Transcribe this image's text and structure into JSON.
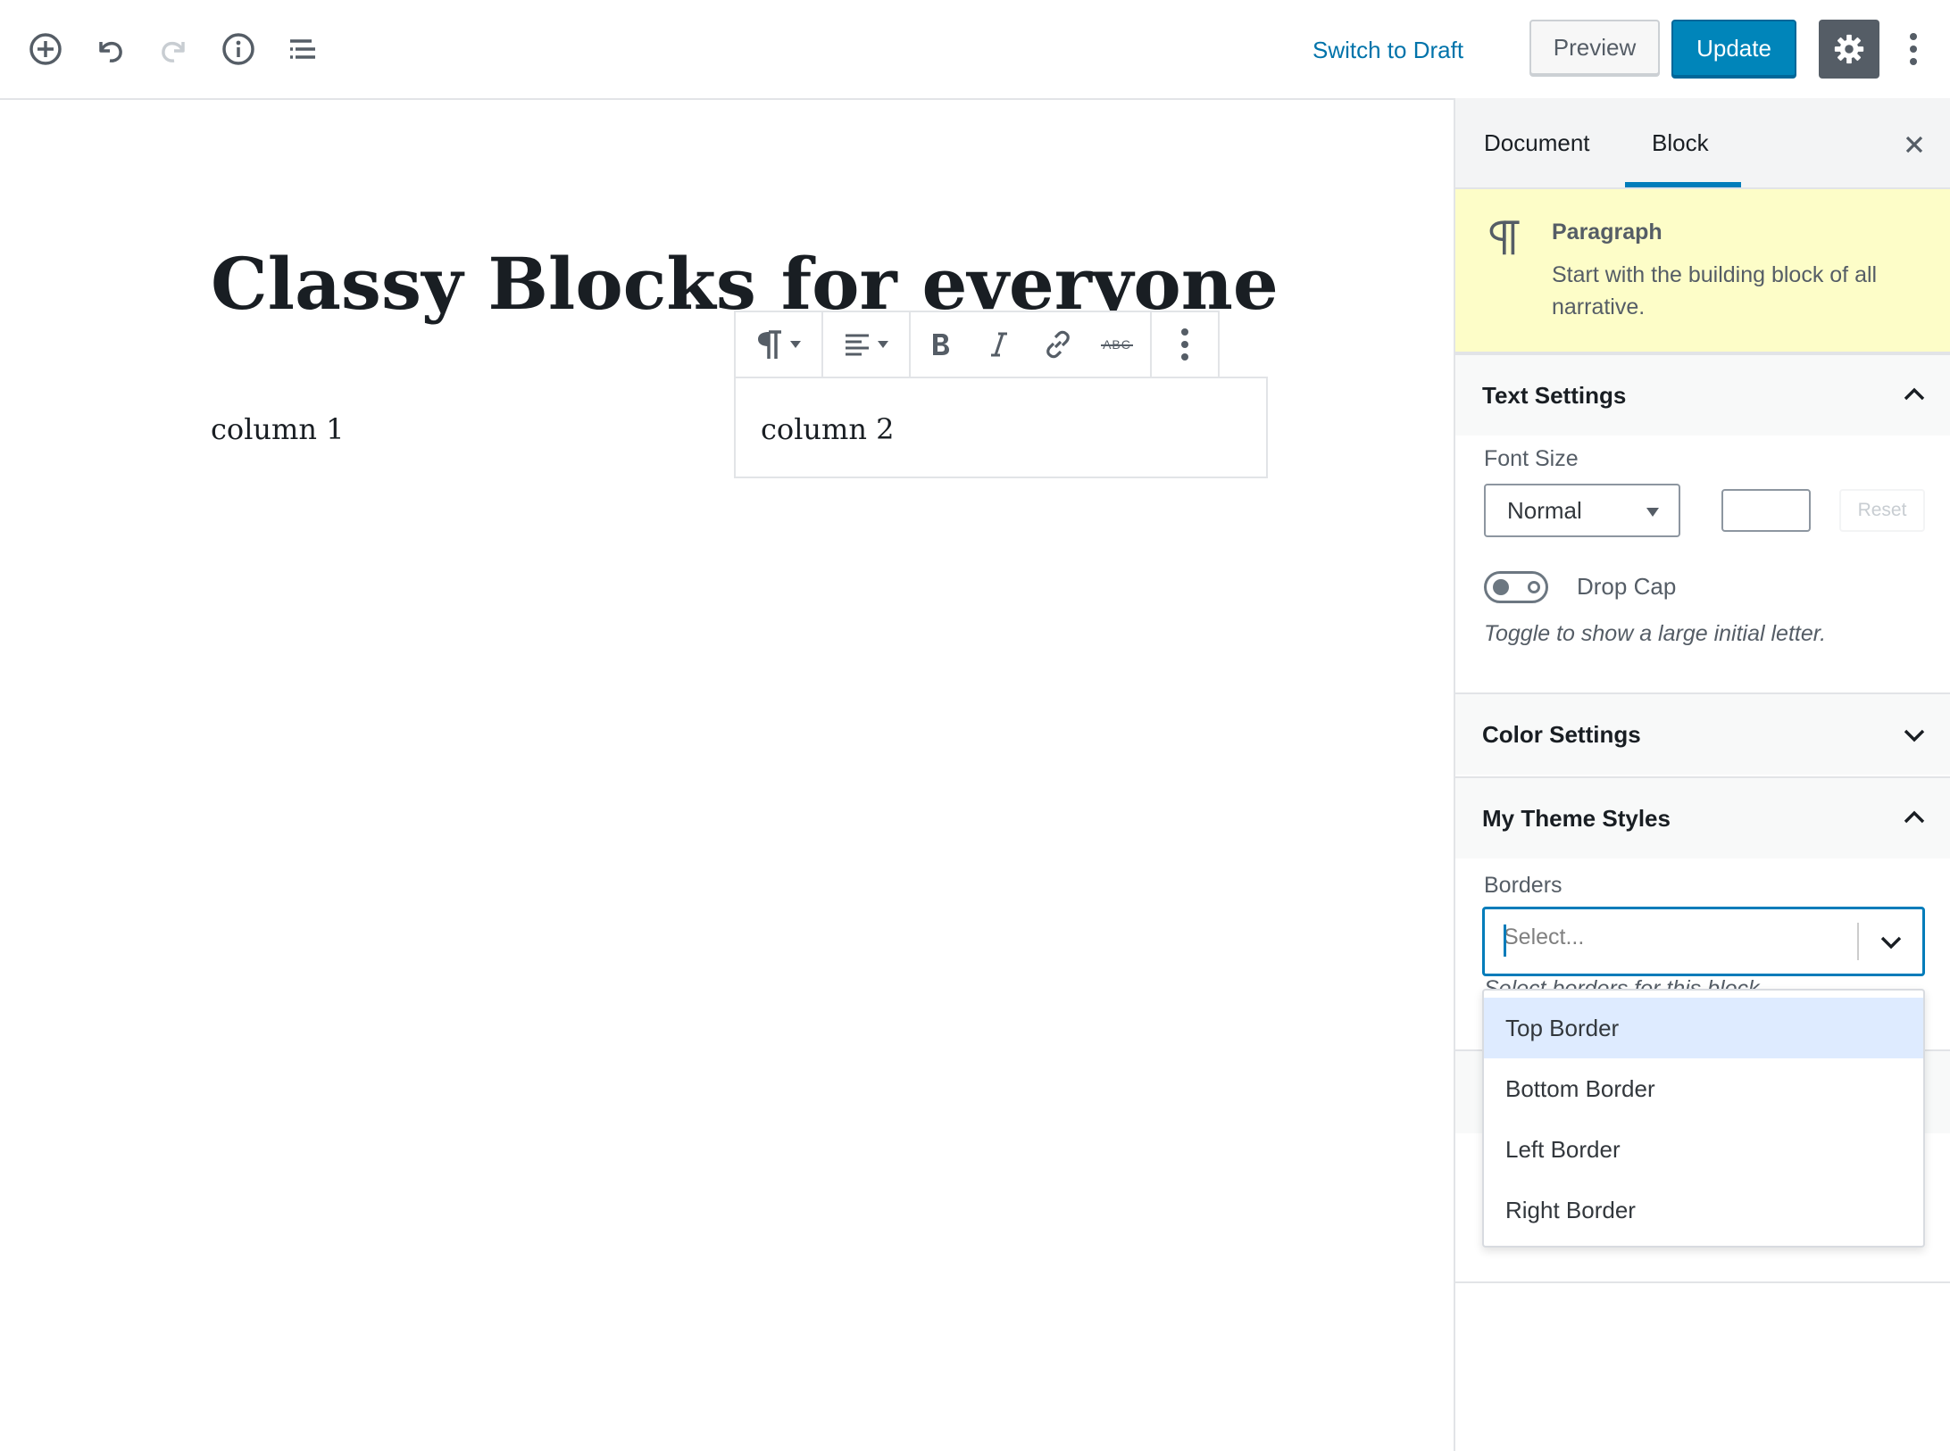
{
  "toolbar": {
    "add_block_icon": "plus-circle-icon",
    "undo_icon": "undo-icon",
    "redo_icon": "redo-icon",
    "info_icon": "info-icon",
    "outline_icon": "list-outline-icon",
    "switch_to_draft": "Switch to Draft",
    "preview": "Preview",
    "update": "Update",
    "settings_icon": "gear-icon",
    "more_icon": "vertical-ellipsis-icon"
  },
  "editor": {
    "title": "Classy Blocks for everyone",
    "column_1": "column 1",
    "column_2": "column 2"
  },
  "block_toolbar": {
    "items": [
      "paragraph-icon",
      "align-left-icon",
      "bold-icon",
      "italic-icon",
      "link-icon",
      "strikethrough-icon",
      "more-options-icon"
    ],
    "strikethrough_text": "ABC"
  },
  "sidebar": {
    "tabs": [
      "Document",
      "Block"
    ],
    "active_tab": "Block",
    "block_card": {
      "title": "Paragraph",
      "description": "Start with the building block of all narrative."
    },
    "text_settings": {
      "title": "Text Settings",
      "font_size_label": "Font Size",
      "font_size_value": "Normal",
      "reset": "Reset",
      "drop_cap_label": "Drop Cap",
      "drop_cap_help": "Toggle to show a large initial letter."
    },
    "color_settings": {
      "title": "Color Settings"
    },
    "theme_styles": {
      "title": "My Theme Styles",
      "borders_label": "Borders",
      "borders_placeholder": "Select...",
      "borders_help": "Select borders for this block.",
      "options": [
        "Top Border",
        "Bottom Border",
        "Left Border",
        "Right Border"
      ],
      "highlighted_option": "Top Border"
    }
  },
  "colors": {
    "accent": "#007cba",
    "primary_button": "#0085ba",
    "block_card_bg": "#fdfdc8",
    "highlight_option": "#deebff"
  }
}
